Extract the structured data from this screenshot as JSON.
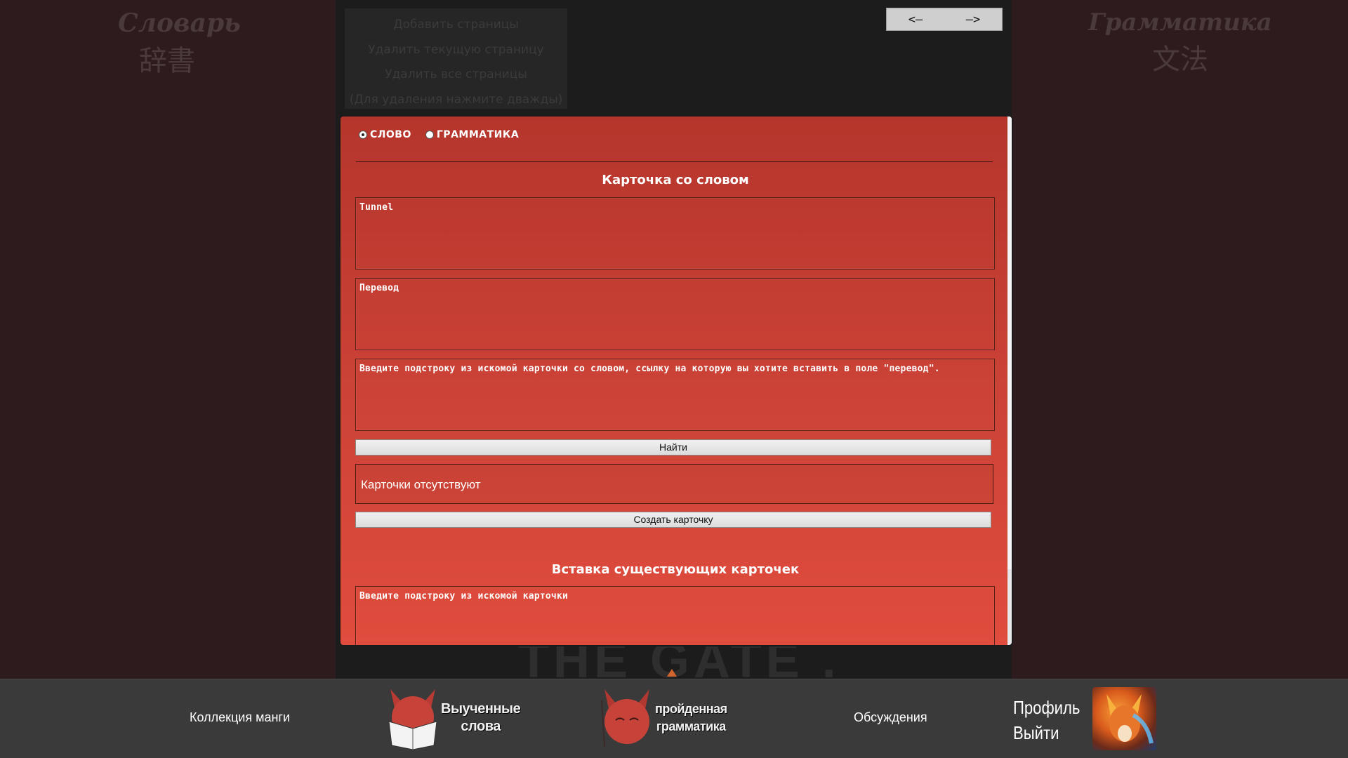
{
  "sidebar_left": {
    "title": "Словарь",
    "subtitle": "辞書"
  },
  "sidebar_right": {
    "title": "Грамматика",
    "subtitle": "文法"
  },
  "page_menu": {
    "add": "Добавить страницы",
    "delete_current": "Удалить текущую страницу",
    "delete_all": "Удалить все страницы",
    "hint": "(Для удаления нажмите дважды)"
  },
  "nav": {
    "prev": "<—",
    "next": "—>"
  },
  "background_text": "THE GATE .",
  "panel": {
    "radio_word": "СЛОВО",
    "radio_grammar": "ГРАММАТИКА",
    "word_card_title": "Карточка со словом",
    "word_field": "Tunnel",
    "translation_placeholder": "Перевод",
    "search_placeholder": "Введите подстроку из искомой карточки со словом, ссылку на которую вы хотите вставить в поле \"перевод\".",
    "find_button": "Найти",
    "no_cards": "Карточки отсутствуют",
    "create_button": "Создать карточку",
    "insert_title": "Вставка существующих карточек",
    "insert_placeholder": "Введите подстроку из искомой карточки"
  },
  "footer": {
    "manga": "Коллекция манги",
    "learned_line1": "Выученные",
    "learned_line2": "слова",
    "grammar_line1": "пройденная",
    "grammar_line2": "грамматика",
    "discussions": "Обсуждения",
    "profile": "Профиль",
    "logout": "Выйти"
  },
  "colors": {
    "panel_top": "#b5352c",
    "panel_bottom": "#e04c3d",
    "footer": "#3a3a3a",
    "fox": "#c7433a"
  }
}
